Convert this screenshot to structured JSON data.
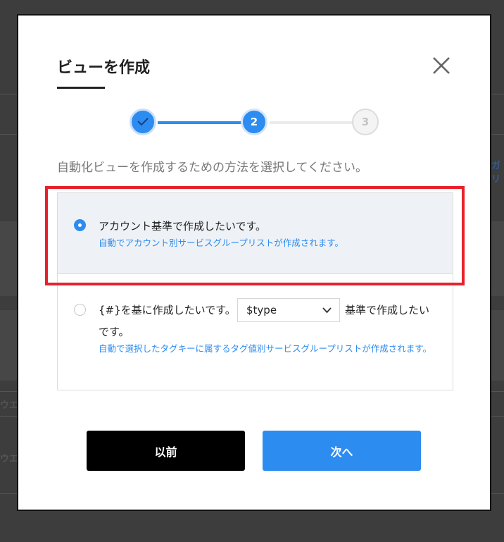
{
  "dialog": {
    "title": "ビューを作成",
    "close_icon": "close-icon",
    "instruction": "自動化ビューを作成するための方法を選択してください。"
  },
  "steps": [
    {
      "label": "",
      "state": "done",
      "icon": "check-icon"
    },
    {
      "label": "2",
      "state": "current"
    },
    {
      "label": "3",
      "state": "pending"
    }
  ],
  "options": [
    {
      "label": "アカウント基準で作成したいです。",
      "description": "自動でアカウント別サービスグループリストが作成されます。",
      "selected": true
    },
    {
      "label_prefix": "{#}を基に作成したいです。",
      "select_value": "$type",
      "label_suffix": "基準で作成したい",
      "label_end": "です。",
      "description": "自動で選択したタグキーに属するタグ値別サービスグループリストが作成されます。",
      "selected": false
    }
  ],
  "buttons": {
    "prev": "以前",
    "next": "次へ"
  },
  "background": {
    "left_frag_1": "ウエ",
    "left_frag_2": "ウエ",
    "right_link": "ガリ"
  },
  "colors": {
    "accent": "#2d8cf0",
    "highlight": "#e8202a"
  }
}
